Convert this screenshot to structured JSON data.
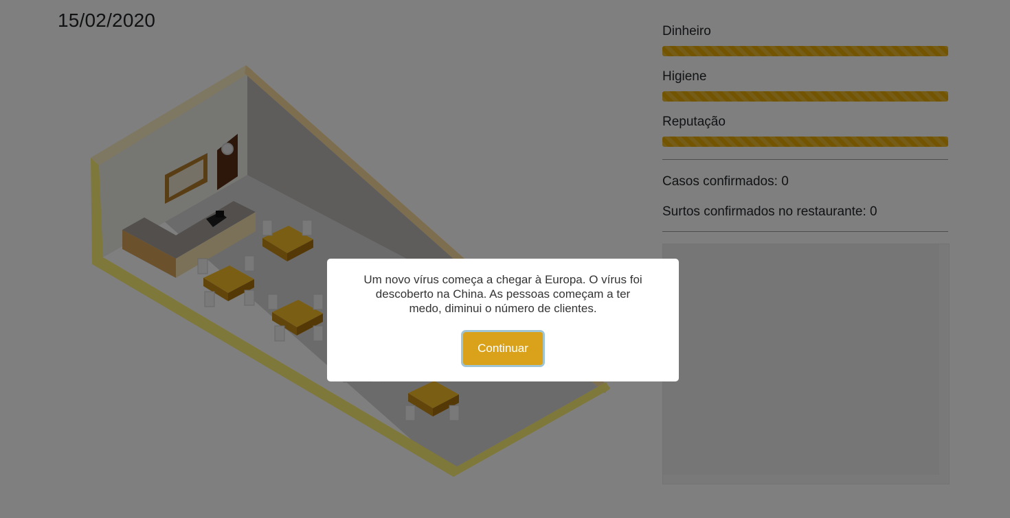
{
  "date": "15/02/2020",
  "stats": [
    {
      "label": "Dinheiro",
      "level": 1.0
    },
    {
      "label": "Higiene",
      "level": 1.0
    },
    {
      "label": "Reputação",
      "level": 1.0
    }
  ],
  "counters": {
    "cases_label": "Casos confirmados:",
    "cases_value": "0",
    "outbreaks_label": "Surtos confirmados no restaurante:",
    "outbreaks_value": "0"
  },
  "modal": {
    "message": "Um novo vírus começa a chegar à Europa. O vírus foi descoberto na China. As pessoas começam a ter medo, diminui o número de clientes.",
    "button_label": "Continuar"
  },
  "colors": {
    "accent": "#e7a900",
    "button": "#d9a21a",
    "wall": "#f1da7a",
    "table_top": "#e3a91c"
  }
}
